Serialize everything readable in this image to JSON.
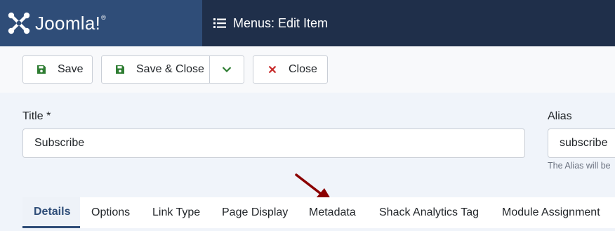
{
  "header": {
    "brand": "Joomla!",
    "brand_mark": "®",
    "page_title": "Menus: Edit Item",
    "title_icon": "list-icon"
  },
  "toolbar": {
    "save_label": "Save",
    "save_close_label": "Save & Close",
    "close_label": "Close",
    "icons": {
      "save": "floppy-disk-icon",
      "dropdown": "chevron-down-icon",
      "close": "close-x-icon"
    }
  },
  "form": {
    "title_label": "Title *",
    "title_value": "Subscribe",
    "alias_label": "Alias",
    "alias_value": "subscribe",
    "alias_hint": "The Alias will be"
  },
  "tabs": [
    {
      "label": "Details",
      "active": true
    },
    {
      "label": "Options"
    },
    {
      "label": "Link Type"
    },
    {
      "label": "Page Display"
    },
    {
      "label": "Metadata"
    },
    {
      "label": "Shack Analytics Tag"
    },
    {
      "label": "Module Assignment"
    }
  ],
  "annotation": {
    "arrow_color": "#8b0000",
    "points_to": "Metadata"
  },
  "colors": {
    "brand": "#2f4d78",
    "titlebar": "#1f2f4a",
    "save_icon": "#2e7d32",
    "close_icon": "#c62828"
  }
}
